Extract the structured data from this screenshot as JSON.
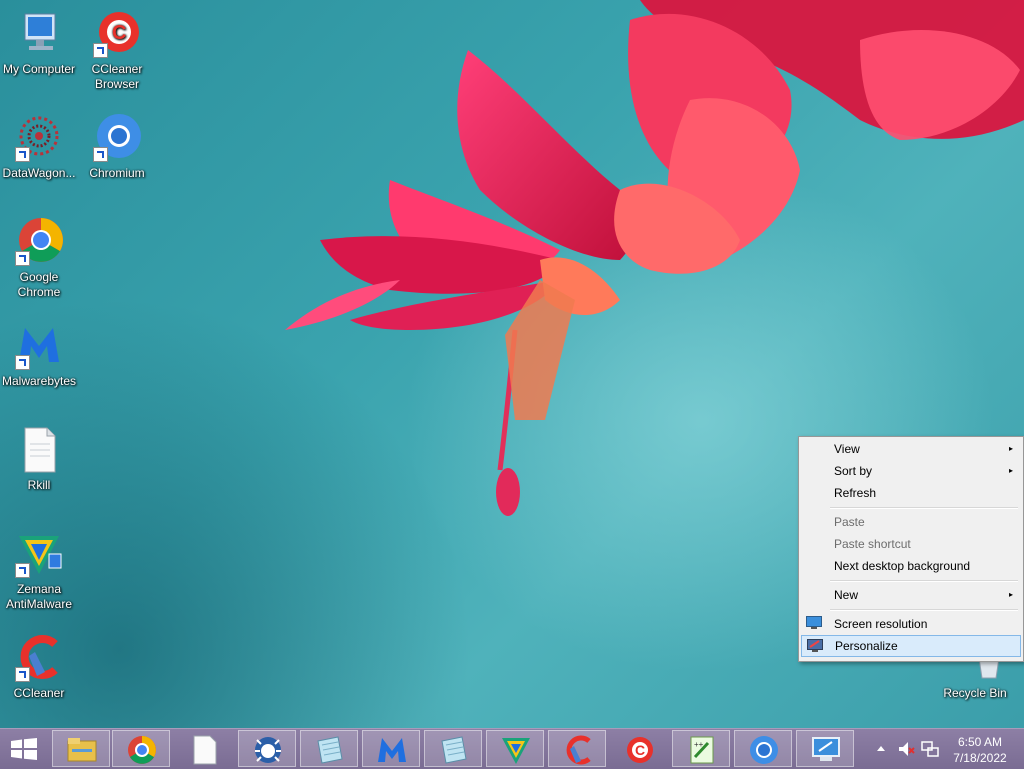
{
  "desktop_icons": [
    {
      "label": "My Computer",
      "icon": "computer-icon"
    },
    {
      "label": "CCleaner Browser",
      "icon": "ccleaner-browser-icon"
    },
    {
      "label": "DataWagon...",
      "icon": "datawagon-icon"
    },
    {
      "label": "Chromium",
      "icon": "chromium-icon"
    },
    {
      "label": "Google Chrome",
      "icon": "chrome-icon"
    },
    {
      "label": "Malwarebytes",
      "icon": "malwarebytes-icon"
    },
    {
      "label": "Rkill",
      "icon": "document-icon"
    },
    {
      "label": "Zemana AntiMalware",
      "icon": "zemana-icon"
    },
    {
      "label": "CCleaner",
      "icon": "ccleaner-icon"
    },
    {
      "label": "Recycle Bin",
      "icon": "recycle-bin-icon"
    }
  ],
  "context_menu": {
    "items": [
      {
        "label": "View",
        "submenu": true
      },
      {
        "label": "Sort by",
        "submenu": true
      },
      {
        "label": "Refresh"
      },
      {
        "label": "Paste",
        "disabled": true
      },
      {
        "label": "Paste shortcut",
        "disabled": true
      },
      {
        "label": "Next desktop background"
      },
      {
        "label": "New",
        "submenu": true
      },
      {
        "label": "Screen resolution",
        "icon": "screen-resolution-icon"
      },
      {
        "label": "Personalize",
        "icon": "personalize-icon",
        "highlighted": true
      }
    ],
    "submenu_arrow": "▸"
  },
  "taskbar": {
    "buttons": [
      "file-explorer-icon",
      "chrome-icon",
      "document-icon",
      "spybot-icon",
      "notepad-icon",
      "malwarebytes-icon",
      "notepad-icon",
      "zemana-icon",
      "ccleaner-icon",
      "ccleaner-browser-icon",
      "notepad-plus-plus-icon",
      "chromium-icon",
      "remote-desktop-icon"
    ],
    "tray": {
      "time": "6:50 AM",
      "date": "7/18/2022",
      "icons": [
        "show-hidden-icons-chevron",
        "volume-muted-icon",
        "network-icon"
      ]
    }
  },
  "colors": {
    "taskbar": "#8d7fa5",
    "menu_bg": "#f0f0f0",
    "menu_highlight": "#d9ebfb"
  }
}
